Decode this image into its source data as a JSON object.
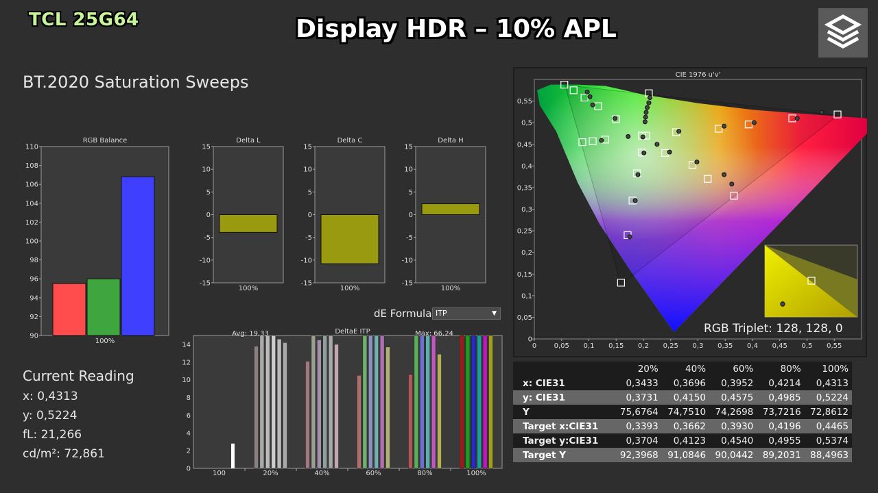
{
  "header": {
    "brand": "TCL 25G64",
    "title": "Display HDR – 10% APL",
    "section": "BT.2020 Saturation Sweeps"
  },
  "reading": {
    "heading": "Current Reading",
    "x": "x: 0,4313",
    "y": "y: 0,5224",
    "fl": "fL: 21,266",
    "cd": "cd/m²: 72,861"
  },
  "formula": {
    "label": "dE Formula:",
    "value": "ITP"
  },
  "colors": {
    "red": "#ff4d4d",
    "green": "#3fa53f",
    "blue": "#3f3fff",
    "delta": "#9a9a10",
    "panel": "#3a3a3a"
  },
  "chart_data": [
    {
      "type": "bar",
      "title": "RGB Balance",
      "categories": [
        "100%"
      ],
      "series": [
        {
          "values": [
            95.5
          ]
        },
        {
          "values": [
            96.0
          ]
        },
        {
          "values": [
            106.8
          ]
        }
      ],
      "ylim": [
        90,
        110
      ],
      "yticks": [
        "90",
        "92",
        "94",
        "96",
        "98",
        "100",
        "102",
        "104",
        "106",
        "108",
        "110"
      ]
    },
    {
      "type": "bar",
      "title": "Delta L",
      "categories": [
        "100%"
      ],
      "values": [
        -3.9
      ],
      "ylim": [
        -15,
        15
      ],
      "yticks": [
        "-15",
        "-10",
        "-5",
        "0",
        "5",
        "10",
        "15"
      ]
    },
    {
      "type": "bar",
      "title": "Delta C",
      "categories": [
        "100%"
      ],
      "values": [
        -10.8
      ],
      "ylim": [
        -15,
        15
      ],
      "yticks": [
        "-15",
        "-10",
        "-5",
        "0",
        "5",
        "10",
        "15"
      ]
    },
    {
      "type": "bar",
      "title": "Delta H",
      "categories": [
        "100%"
      ],
      "values": [
        2.4
      ],
      "ylim": [
        -15,
        15
      ],
      "yticks": [
        "-15",
        "-10",
        "-5",
        "0",
        "5",
        "10",
        "15"
      ]
    },
    {
      "type": "bar",
      "title": "DeltaE ITP",
      "avg_label": "Avg: 19,33",
      "max_label": "Max: 66,24",
      "categories": [
        "100",
        "20%",
        "40%",
        "60%",
        "80%",
        "100%"
      ],
      "ylim": [
        0,
        15
      ],
      "yticks": [
        "0",
        "2",
        "4",
        "6",
        "8",
        "10",
        "12",
        "14"
      ],
      "groups": [
        {
          "values": [
            2.8
          ],
          "colors": [
            "#ffffff"
          ]
        },
        {
          "values": [
            13.8,
            15,
            15,
            15,
            14.6,
            14.2
          ],
          "colors": [
            "#8a8080",
            "#aaaaaa",
            "#bbbbbb",
            "#cccccc",
            "#bbbbbb",
            "#aaaaaa"
          ]
        },
        {
          "values": [
            12.1,
            15,
            14.5,
            15,
            15,
            14.0
          ],
          "colors": [
            "#a07a80",
            "#9aa090",
            "#a090a8",
            "#90a0a0",
            "#a8a8a8",
            "#c0a8b0"
          ]
        },
        {
          "values": [
            10.5,
            15,
            15,
            15,
            15,
            13.7
          ],
          "colors": [
            "#b07070",
            "#70b070",
            "#9090c0",
            "#70b0b0",
            "#b070b0",
            "#b0b070"
          ]
        },
        {
          "values": [
            10.6,
            15,
            15,
            15,
            15,
            12.9
          ],
          "colors": [
            "#b05858",
            "#58b058",
            "#7070d0",
            "#58b0b0",
            "#c058c0",
            "#b0b058"
          ]
        },
        {
          "values": [
            15,
            15,
            15,
            15,
            15,
            15
          ],
          "colors": [
            "#a01818",
            "#18a018",
            "#2828d0",
            "#18a0a0",
            "#c018c0",
            "#a0a018"
          ]
        }
      ]
    },
    {
      "type": "scatter",
      "title": "CIE 1976 u'v'",
      "xlim": [
        0,
        0.6
      ],
      "ylim": [
        0,
        0.6
      ],
      "xticks": [
        "0",
        "0,05",
        "0,1",
        "0,15",
        "0,2",
        "0,25",
        "0,3",
        "0,35",
        "0,4",
        "0,45",
        "0,5",
        "0,55"
      ],
      "yticks": [
        "0",
        "0,05",
        "0,1",
        "0,15",
        "0,2",
        "0,25",
        "0,3",
        "0,35",
        "0,4",
        "0,45",
        "0,5",
        "0,55"
      ],
      "targets": [
        [
          0.055,
          0.588
        ],
        [
          0.072,
          0.575
        ],
        [
          0.092,
          0.558
        ],
        [
          0.117,
          0.538
        ],
        [
          0.15,
          0.508
        ],
        [
          0.21,
          0.568
        ],
        [
          0.197,
          0.47
        ],
        [
          0.088,
          0.455
        ],
        [
          0.107,
          0.457
        ],
        [
          0.13,
          0.461
        ],
        [
          0.197,
          0.431
        ],
        [
          0.24,
          0.43
        ],
        [
          0.188,
          0.383
        ],
        [
          0.18,
          0.32
        ],
        [
          0.171,
          0.24
        ],
        [
          0.159,
          0.13
        ],
        [
          0.26,
          0.478
        ],
        [
          0.29,
          0.402
        ],
        [
          0.338,
          0.486
        ],
        [
          0.393,
          0.496
        ],
        [
          0.473,
          0.51
        ],
        [
          0.556,
          0.519
        ],
        [
          0.318,
          0.37
        ],
        [
          0.366,
          0.331
        ],
        [
          0.205,
          0.47
        ]
      ],
      "measured": [
        [
          0.097,
          0.571
        ],
        [
          0.102,
          0.56
        ],
        [
          0.107,
          0.541
        ],
        [
          0.123,
          0.459
        ],
        [
          0.148,
          0.51
        ],
        [
          0.172,
          0.468
        ],
        [
          0.199,
          0.467
        ],
        [
          0.201,
          0.43
        ],
        [
          0.19,
          0.38
        ],
        [
          0.185,
          0.32
        ],
        [
          0.175,
          0.236
        ],
        [
          0.212,
          0.558
        ],
        [
          0.21,
          0.546
        ],
        [
          0.207,
          0.535
        ],
        [
          0.205,
          0.524
        ],
        [
          0.204,
          0.513
        ],
        [
          0.203,
          0.502
        ],
        [
          0.225,
          0.45
        ],
        [
          0.248,
          0.432
        ],
        [
          0.265,
          0.48
        ],
        [
          0.298,
          0.409
        ],
        [
          0.348,
          0.492
        ],
        [
          0.403,
          0.5
        ],
        [
          0.482,
          0.51
        ],
        [
          0.527,
          0.524
        ],
        [
          0.348,
          0.38
        ],
        [
          0.362,
          0.358
        ]
      ],
      "inset_label": "RGB Triplet: 128, 128, 0"
    },
    {
      "type": "table",
      "columns": [
        "",
        "20%",
        "40%",
        "60%",
        "80%",
        "100%"
      ],
      "rows": [
        [
          "x: CIE31",
          "0,3433",
          "0,3696",
          "0,3952",
          "0,4214",
          "0,4313"
        ],
        [
          "y: CIE31",
          "0,3731",
          "0,4150",
          "0,4575",
          "0,4985",
          "0,5224"
        ],
        [
          "Y",
          "75,6764",
          "74,7510",
          "74,2698",
          "73,7216",
          "72,8612"
        ],
        [
          "Target x:CIE31",
          "0,3393",
          "0,3662",
          "0,3930",
          "0,4196",
          "0,4465"
        ],
        [
          "Target y:CIE31",
          "0,3704",
          "0,4123",
          "0,4540",
          "0,4955",
          "0,5374"
        ],
        [
          "Target Y",
          "92,3968",
          "91,0846",
          "90,0442",
          "89,2031",
          "88,4963"
        ]
      ]
    }
  ]
}
